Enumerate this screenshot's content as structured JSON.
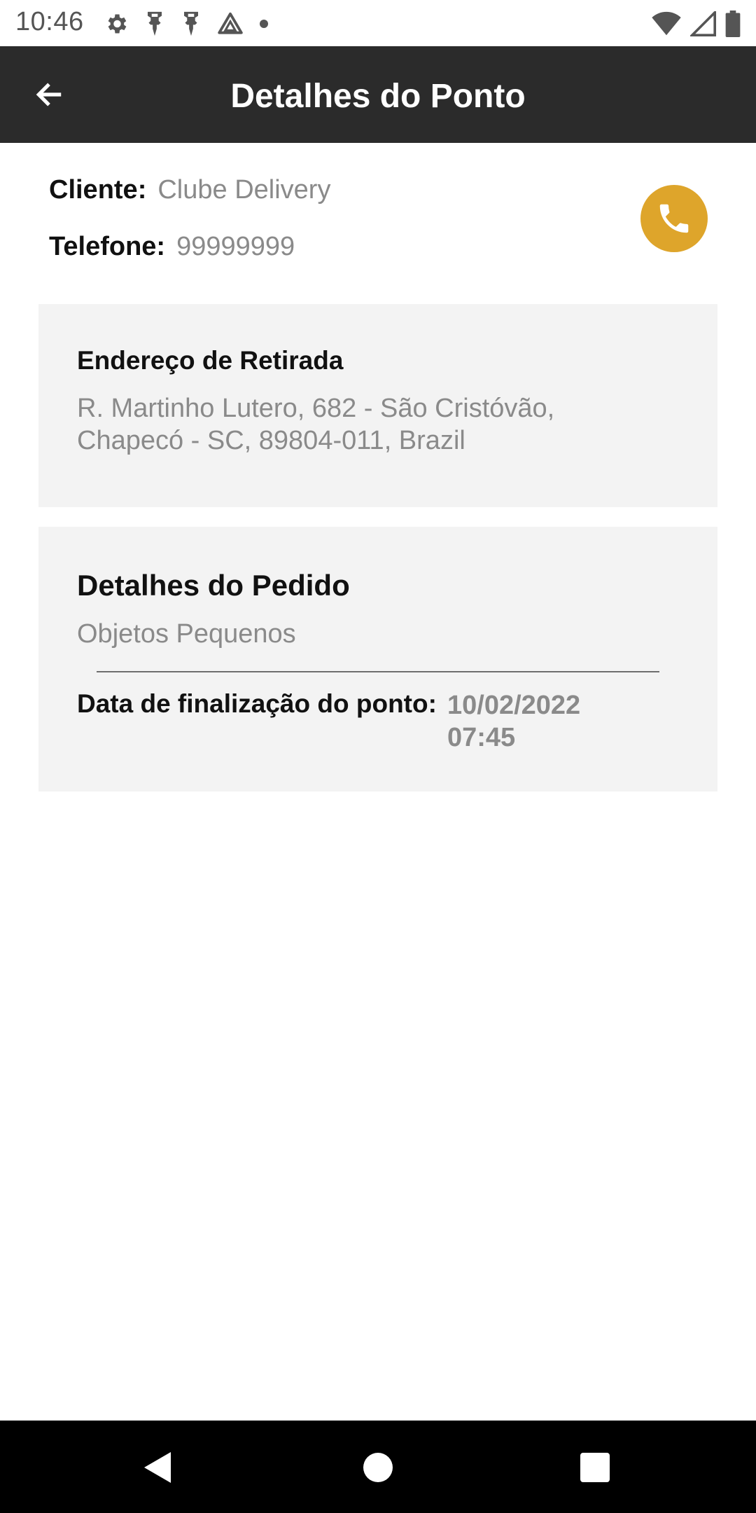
{
  "status_bar": {
    "time": "10:46",
    "icons_left": [
      "settings-icon",
      "notification-icon",
      "notification-icon",
      "drive-icon",
      "dot-icon"
    ],
    "icons_right": [
      "wifi-icon",
      "signal-icon",
      "battery-icon"
    ]
  },
  "app_bar": {
    "title": "Detalhes do Ponto",
    "back_icon": "arrow-left-icon",
    "background": "#2b2b2b"
  },
  "client": {
    "client_label": "Cliente:",
    "client_value": "Clube Delivery",
    "phone_label": "Telefone:",
    "phone_value": "99999999",
    "call_icon": "phone-icon",
    "call_button_color": "#dea52b"
  },
  "pickup": {
    "heading": "Endereço de Retirada",
    "address": "R. Martinho Lutero, 682 - São Cristóvão, Chapecó - SC, 89804-011, Brazil"
  },
  "order": {
    "heading": "Detalhes do Pedido",
    "description": "Objetos Pequenos",
    "finish_label": "Data de finalização do ponto:",
    "finish_value": "10/02/2022 07:45"
  },
  "nav_bar": {
    "icons": [
      "nav-back-icon",
      "nav-home-icon",
      "nav-recents-icon"
    ]
  }
}
